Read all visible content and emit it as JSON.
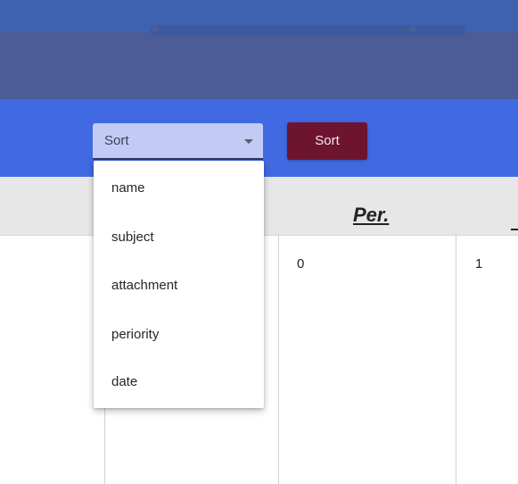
{
  "toolbar": {
    "sort_select_value": "Sort",
    "sort_button_label": "Sort"
  },
  "sort_menu": {
    "options": [
      "name",
      "subject",
      "attachment",
      "periority",
      "date"
    ]
  },
  "table": {
    "header_label": "Per.",
    "row_values": [
      "0",
      "1"
    ]
  },
  "colors": {
    "top_band": "#4b5c96",
    "toolbar": "#4169e1",
    "select_background": "#c2cbf3",
    "sort_button": "#6d1430",
    "header_row": "#e7e7e7"
  },
  "icons": {
    "select_caret": "caret-down-icon"
  }
}
